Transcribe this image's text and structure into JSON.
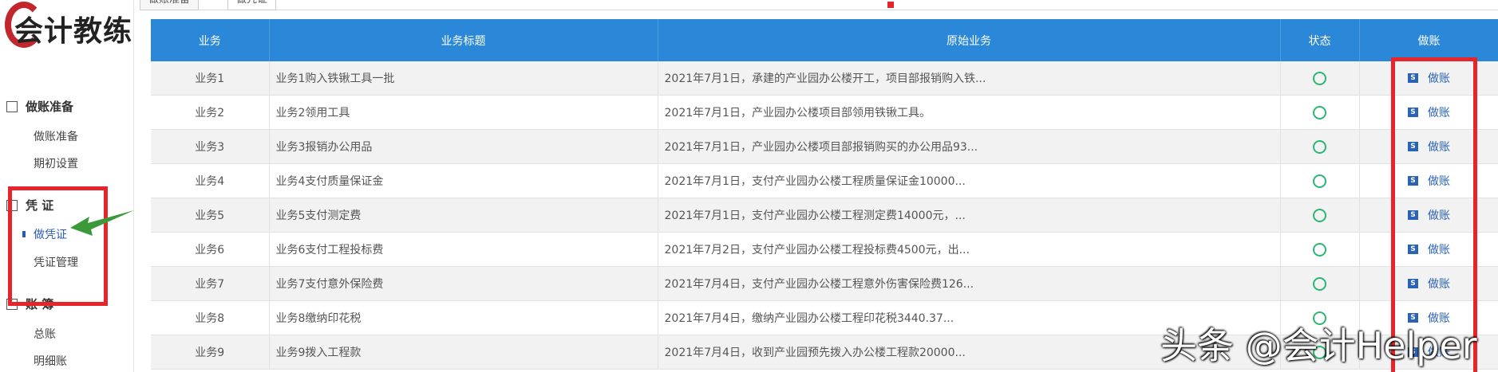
{
  "brand": {
    "logo_text": "会计教练"
  },
  "sidebar": {
    "groups": [
      {
        "label": "做账准备",
        "icon": "edit-icon"
      },
      {
        "label": "凭  证",
        "icon": "voucher-icon"
      },
      {
        "label": "账  簿",
        "icon": "ledger-icon"
      }
    ],
    "items": [
      {
        "label": "做账准备"
      },
      {
        "label": "期初设置"
      },
      {
        "label": "做凭证"
      },
      {
        "label": "凭证管理"
      },
      {
        "label": "总账"
      },
      {
        "label": "明细账"
      }
    ]
  },
  "tabs": [
    {
      "label": "做账准备"
    },
    {
      "label": "做凭证"
    }
  ],
  "table": {
    "headers": [
      "业务",
      "业务标题",
      "原始业务",
      "状态",
      "做账"
    ],
    "rows": [
      {
        "id": "业务1",
        "title": "业务1购入铁锹工具一批",
        "desc": "2021年7月1日，承建的产业园办公楼开工，项目部报销购入铁...",
        "action": "做账"
      },
      {
        "id": "业务2",
        "title": "业务2领用工具",
        "desc": "2021年7月1日，产业园办公楼项目部领用铁锹工具。",
        "action": "做账"
      },
      {
        "id": "业务3",
        "title": "业务3报销办公用品",
        "desc": "2021年7月1日，产业园办公楼项目部报销购买的办公用品93...",
        "action": "做账"
      },
      {
        "id": "业务4",
        "title": "业务4支付质量保证金",
        "desc": "2021年7月1日，支付产业园办公楼工程质量保证金10000...",
        "action": "做账"
      },
      {
        "id": "业务5",
        "title": "业务5支付测定费",
        "desc": "2021年7月1日，支付产业园办公楼工程测定费14000元，...",
        "action": "做账"
      },
      {
        "id": "业务6",
        "title": "业务6支付工程投标费",
        "desc": "2021年7月2日，支付产业园办公楼工程投标费4500元，出...",
        "action": "做账"
      },
      {
        "id": "业务7",
        "title": "业务7支付意外保险费",
        "desc": "2021年7月4日，支付产业园办公楼工程意外伤害保险费126...",
        "action": "做账"
      },
      {
        "id": "业务8",
        "title": "业务8缴纳印花税",
        "desc": "2021年7月4日，缴纳产业园办公楼工程印花税3440.37...",
        "action": "做账"
      },
      {
        "id": "业务9",
        "title": "业务9拨入工程款",
        "desc": "2021年7月4日，收到产业园预先拨入办公楼工程款20000...",
        "action": "做账"
      }
    ]
  },
  "watermark": "头条 @会计Helper",
  "colors": {
    "header_blue": "#2b88d8",
    "highlight_red": "#e8242b",
    "status_green": "#2bb673",
    "link_blue": "#2a63b6"
  }
}
